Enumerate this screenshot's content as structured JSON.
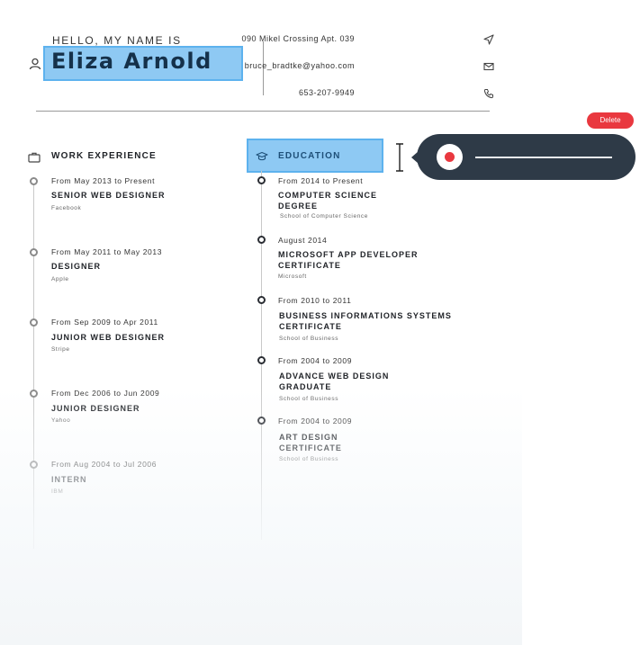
{
  "header": {
    "greeting": "HELLO, MY NAME IS",
    "name": "Eliza Arnold",
    "address": "090 Mikel Crossing Apt. 039",
    "email": "bruce_bradtke@yahoo.com",
    "phone": "653-207-9949"
  },
  "work": {
    "title": "WORK EXPERIENCE",
    "items": [
      {
        "date": "From May 2013 to Present",
        "title": "SENIOR WEB DESIGNER",
        "company": "Facebook"
      },
      {
        "date": "From May 2011 to May 2013",
        "title": "DESIGNER",
        "company": "Apple"
      },
      {
        "date": "From Sep 2009 to Apr 2011",
        "title": "JUNIOR WEB DESIGNER",
        "company": "Stripe"
      },
      {
        "date": "From Dec 2006 to Jun 2009",
        "title": "JUNIOR  DESIGNER",
        "company": "Yahoo"
      },
      {
        "date": "From Aug 2004 to Jul 2006",
        "title": "INTERN",
        "company": "IBM"
      }
    ]
  },
  "education": {
    "title": "EDUCATION",
    "items": [
      {
        "date": "From 2014 to Present",
        "title": "COMPUTER SCIENCE DEGREE",
        "school": "School of Computer Science"
      },
      {
        "date": "August 2014",
        "title": "MICROSOFT APP DEVELOPER CERTIFICATE",
        "school": "Microsoft"
      },
      {
        "date": "From 2010 to 2011",
        "title": "BUSINESS INFORMATIONS SYSTEMS CERTIFICATE",
        "school": "School of Business"
      },
      {
        "date": "From 2004 to 2009",
        "title": "ADVANCE WEB DESIGN GRADUATE",
        "school": "School of Business"
      },
      {
        "date": "From 2004 to 2009",
        "title": "ART DESIGN CERTIFICATE",
        "school": "School of Business"
      }
    ]
  },
  "audio": {
    "delete_label": "Delete"
  },
  "colors": {
    "highlight": "#8ec9f3",
    "highlight_border": "#5db2ee",
    "popup_bg": "#2e3a47",
    "delete": "#e9383f",
    "record": "#e9383f"
  },
  "icons": {
    "user": "user-icon",
    "address": "send-icon",
    "email": "envelope-icon",
    "phone": "phone-icon",
    "work": "briefcase-icon",
    "education": "graduation-cap-icon",
    "cursor": "text-cursor-icon",
    "record": "record-icon"
  }
}
